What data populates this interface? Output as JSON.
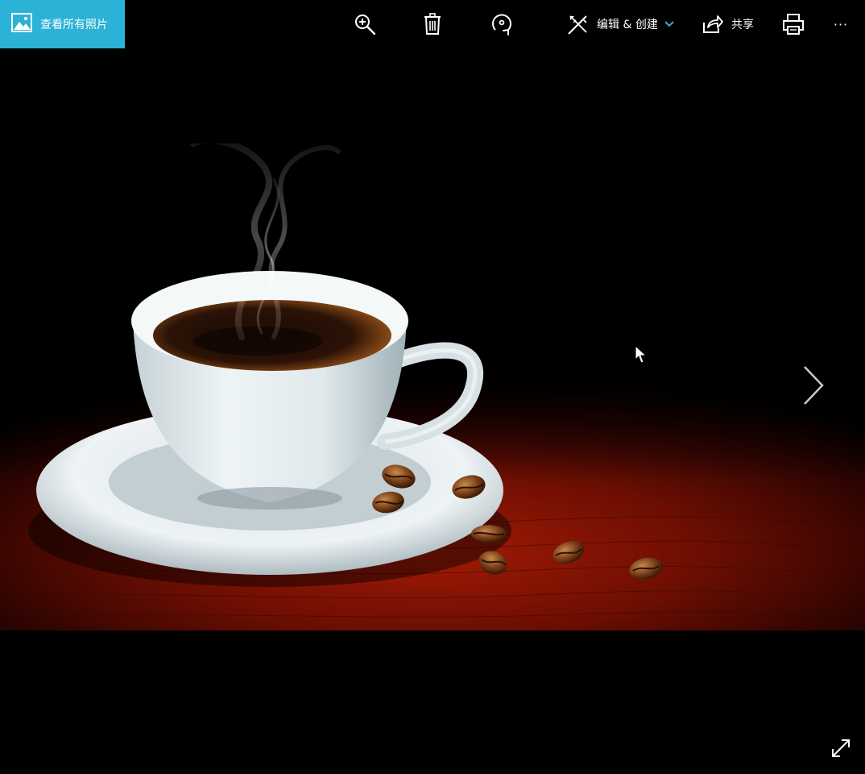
{
  "toolbar": {
    "view_all_label": "查看所有照片",
    "edit_create_label": "编辑 & 创建",
    "share_label": "共享",
    "more_label": "···",
    "icons": {
      "view_all": "photos-app-icon",
      "zoom": "zoom-in-icon",
      "delete": "trash-icon",
      "rotate": "rotate-icon",
      "edit": "edit-create-icon",
      "dropdown": "chevron-down-icon",
      "share": "share-icon",
      "print": "print-icon"
    }
  },
  "viewer": {
    "next_icon": "chevron-right-icon",
    "fullscreen_icon": "expand-icon",
    "photo_subject": "coffee-cup-photo"
  },
  "colors": {
    "accent": "#2BB2D6",
    "background": "#000000",
    "chevron_accent": "#3FA9D8"
  }
}
